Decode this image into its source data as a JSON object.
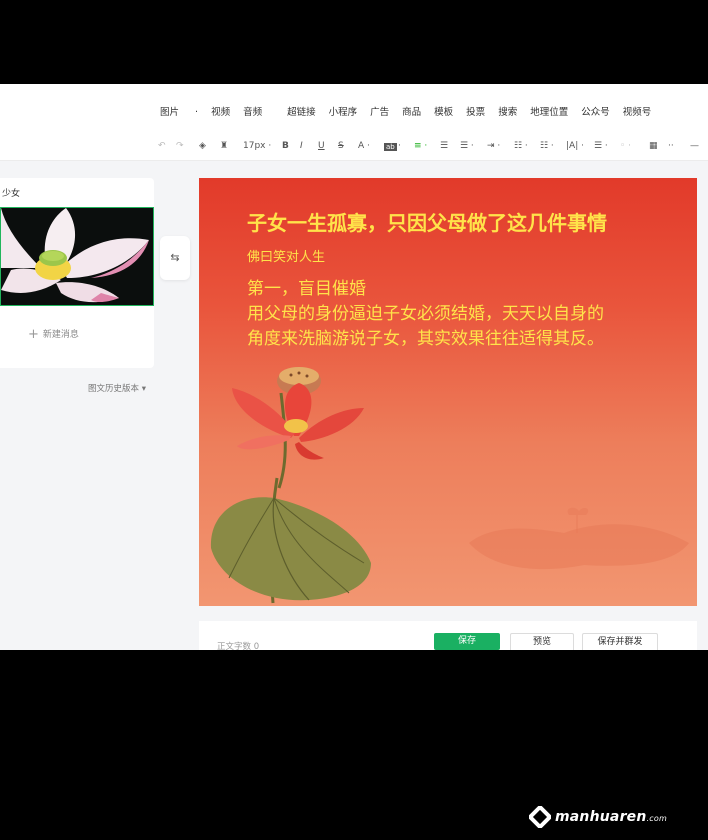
{
  "menu": [
    "图片",
    "视频",
    "音频",
    "超链接",
    "小程序",
    "广告",
    "商品",
    "模板",
    "投票",
    "搜索",
    "地理位置",
    "公众号",
    "视频号"
  ],
  "menu_dropdown_marks": [
    "·"
  ],
  "toolbar": {
    "font_size": "17px",
    "undo_icon": "undo-icon",
    "redo_icon": "redo-icon"
  },
  "left_panel": {
    "article_title": "少女",
    "new_message": "新建消息",
    "history": "图文历史版本"
  },
  "article": {
    "title": "子女一生孤寡，只因父母做了这几件事情",
    "author": "佛曰笑对人生",
    "heading": "第一，盲目催婚",
    "body_line1": "用父母的身份逼迫子女必须结婚，天天以自身的",
    "body_line2": "角度来洗脑游说子女，其实效果往往适得其反。"
  },
  "footer": {
    "word_count": "正文字数 0",
    "save": "保存",
    "preview": "预览",
    "save_and_send": "保存并群发"
  },
  "watermark": {
    "text": "manhuaren",
    "suffix": ".com"
  },
  "colors": {
    "accent": "#1ab062",
    "title_yellow": "#ffe34a",
    "canvas_red": "#e23a2a"
  }
}
